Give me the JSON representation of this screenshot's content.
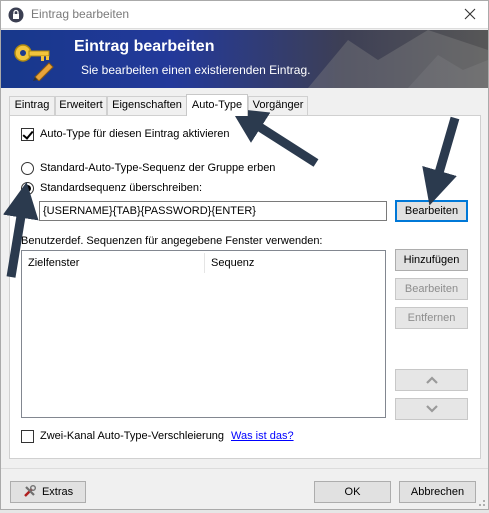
{
  "window": {
    "title": "Eintrag bearbeiten"
  },
  "banner": {
    "title": "Eintrag bearbeiten",
    "subtitle": "Sie bearbeiten einen existierenden Eintrag."
  },
  "tabs": [
    {
      "label": "Eintrag",
      "active": false
    },
    {
      "label": "Erweitert",
      "active": false
    },
    {
      "label": "Eigenschaften",
      "active": false
    },
    {
      "label": "Auto-Type",
      "active": true
    },
    {
      "label": "Vorgänger",
      "active": false
    }
  ],
  "autotype": {
    "enable_label": "Auto-Type für diesen Eintrag aktivieren",
    "enable_checked": true,
    "inherit_label": "Standard-Auto-Type-Sequenz der Gruppe erben",
    "override_label": "Standardsequenz überschreiben:",
    "override_selected": true,
    "sequence_value": "{USERNAME}{TAB}{PASSWORD}{ENTER}",
    "edit_button": "Bearbeiten",
    "custom_label": "Benutzerdef. Sequenzen für angegebene Fenster verwenden:",
    "columns": [
      "Zielfenster",
      "Sequenz"
    ],
    "add_button": "Hinzufügen",
    "edit2_button": "Bearbeiten",
    "remove_button": "Entfernen",
    "obfuscation_label": "Zwei-Kanal Auto-Type-Verschleierung",
    "obfuscation_checked": false,
    "help_link": "Was ist das?"
  },
  "footer": {
    "extras_button": "Extras",
    "ok_button": "OK",
    "cancel_button": "Abbrechen"
  },
  "colors": {
    "accent": "#0078d7",
    "banner_start": "#17388b",
    "annotation_arrow": "#2b3a4e",
    "link": "#0000ff"
  }
}
